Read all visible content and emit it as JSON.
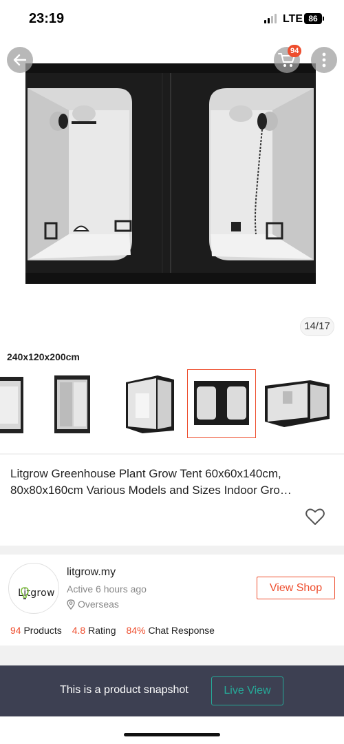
{
  "status_bar": {
    "time": "23:19",
    "network": "LTE",
    "battery": "86"
  },
  "hero": {
    "cart_badge": "94",
    "image_counter": "14/17",
    "icons": [
      "back-arrow-icon",
      "cart-icon",
      "more-dots-icon"
    ]
  },
  "variant": {
    "label": "240x120x200cm",
    "selected_index": 3
  },
  "product": {
    "title": "Litgrow Greenhouse Plant Grow Tent 60x60x140cm, 80x80x160cm Various Models and Sizes Indoor Gro…"
  },
  "shop": {
    "logo_text": "Litgrow",
    "name": "litgrow.my",
    "active": "Active 6 hours ago",
    "location": "Overseas",
    "view_shop_label": "View Shop",
    "stats": [
      {
        "value": "94",
        "label": "Products"
      },
      {
        "value": "4.8",
        "label": "Rating"
      },
      {
        "value": "84%",
        "label": "Chat Response"
      }
    ]
  },
  "snapshot": {
    "message": "This is a product snapshot",
    "live_view_label": "Live View"
  },
  "colors": {
    "accent": "#ee4d2d",
    "teal": "#26aa99",
    "snapshot_bg": "#3d4052"
  }
}
